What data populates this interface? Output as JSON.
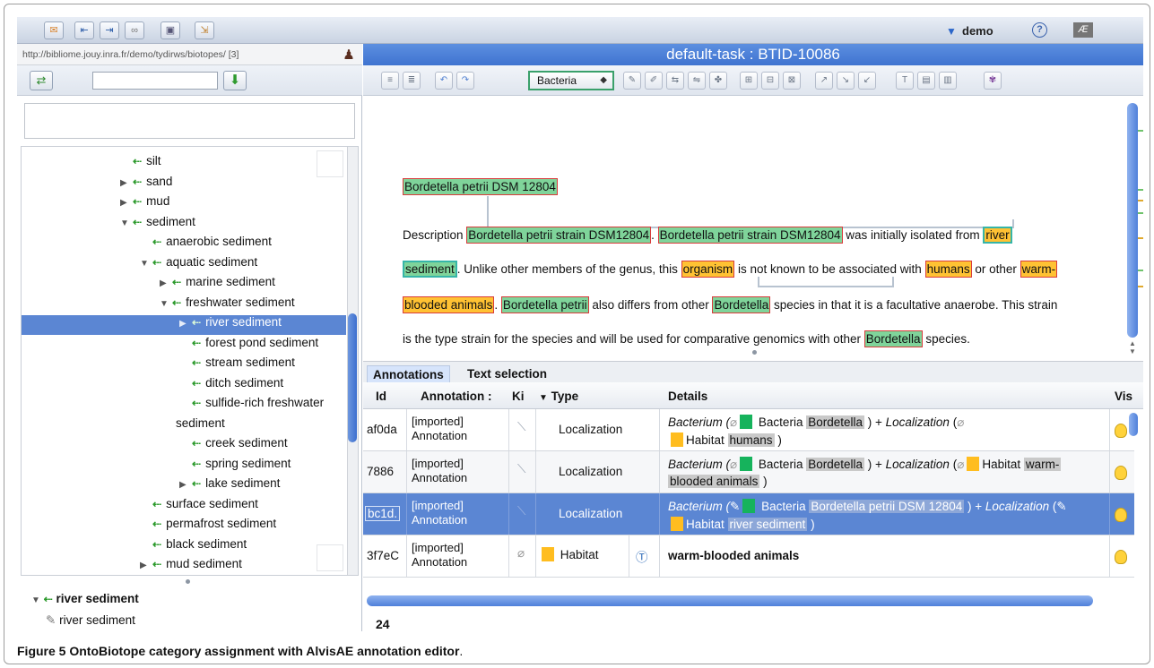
{
  "topbar": {
    "user": "demo",
    "help_label": "?",
    "logo": "Æ"
  },
  "left": {
    "url": "http://bibliome.jouy.inra.fr/demo/tydirws/biotopes/ [3]",
    "search": {
      "value": "",
      "placeholder": ""
    },
    "tree": [
      {
        "label": "silt",
        "twisty": "",
        "depth": 0,
        "selected": false
      },
      {
        "label": "sand",
        "twisty": "▶",
        "depth": 0,
        "selected": false
      },
      {
        "label": "mud",
        "twisty": "▶",
        "depth": 0,
        "selected": false
      },
      {
        "label": "sediment",
        "twisty": "▼",
        "depth": 0,
        "selected": false
      },
      {
        "label": "anaerobic sediment",
        "twisty": "",
        "depth": 1,
        "selected": false
      },
      {
        "label": "aquatic sediment",
        "twisty": "▼",
        "depth": 1,
        "selected": false
      },
      {
        "label": "marine sediment",
        "twisty": "▶",
        "depth": 2,
        "selected": false
      },
      {
        "label": "freshwater sediment",
        "twisty": "▼",
        "depth": 2,
        "selected": false
      },
      {
        "label": "river sediment",
        "twisty": "▶",
        "depth": 3,
        "selected": true
      },
      {
        "label": "forest pond sediment",
        "twisty": "",
        "depth": 3,
        "selected": false
      },
      {
        "label": "stream sediment",
        "twisty": "",
        "depth": 3,
        "selected": false
      },
      {
        "label": "ditch sediment",
        "twisty": "",
        "depth": 3,
        "selected": false
      },
      {
        "label": "sulfide-rich freshwater",
        "twisty": "",
        "depth": 3,
        "selected": false
      },
      {
        "label": "sediment",
        "twisty": "",
        "depth": 3,
        "selected": false
      },
      {
        "label": "creek sediment",
        "twisty": "",
        "depth": 3,
        "selected": false
      },
      {
        "label": "spring sediment",
        "twisty": "",
        "depth": 3,
        "selected": false
      },
      {
        "label": "lake sediment",
        "twisty": "▶",
        "depth": 3,
        "selected": false
      },
      {
        "label": "surface sediment",
        "twisty": "",
        "depth": 1,
        "selected": false
      },
      {
        "label": "permafrost sediment",
        "twisty": "",
        "depth": 1,
        "selected": false
      },
      {
        "label": "black sediment",
        "twisty": "",
        "depth": 1,
        "selected": false
      },
      {
        "label": "mud sediment",
        "twisty": "▶",
        "depth": 1,
        "selected": false
      }
    ],
    "detail": {
      "node": "river sediment",
      "term": "river sediment"
    }
  },
  "editor": {
    "title": "default-task : BTID-10086",
    "type_select": "Bacteria",
    "doc": {
      "title_ann": "Bordetella petrii DSM 12804",
      "l1_a": "Description ",
      "l1_b": "Bordetella petrii strain DSM12804",
      "l1_c": ". ",
      "l1_d": "Bordetella petrii strain DSM12804",
      "l1_e": " was initially isolated from ",
      "l1_f": "river",
      "l2_a": "sediment",
      "l2_b": ". Unlike other members of the genus, this ",
      "l2_c": "organism",
      "l2_d": " is not known to be associated with ",
      "l2_e": "humans",
      "l2_f": " or other ",
      "l2_g": "warm-",
      "l3_a": "blooded animals",
      "l3_b": ". ",
      "l3_c": "Bordetella petrii",
      "l3_d": " also differs from other ",
      "l3_e": "Bordetella",
      "l3_f": " species in that it is a facultative anaerobe. This strain",
      "l4_a": "is the type strain for the species and will be used for comparative genomics with other ",
      "l4_b": "Bordetella",
      "l4_c": " species."
    },
    "tabs": [
      "Annotations",
      "Text selection"
    ],
    "grid": {
      "headers": {
        "id": "Id",
        "annotation": "Annotation :",
        "kind": "Ki",
        "type": "Type",
        "details": "Details",
        "vis": "Vis"
      },
      "rows": [
        {
          "id": "af0da",
          "ann1": "[imported]",
          "ann2": "Annotation",
          "type": "Localization",
          "d1": "Bacterium (",
          "d2": " Bacteria ",
          "d3": "Bordetella",
          "d4": " ) + ",
          "d5": "Localization",
          "d6": " (",
          "d7": "Habitat ",
          "d8": "humans",
          "d9": " )"
        },
        {
          "id": "7886",
          "ann1": "[imported]",
          "ann2": "Annotation",
          "type": "Localization",
          "d1": "Bacterium (",
          "d2": " Bacteria ",
          "d3": "Bordetella",
          "d4": " ) + ",
          "d5": "Localization",
          "d6": " (",
          "d7": "Habitat ",
          "d8": "warm-",
          "d8b": "blooded animals",
          "d9": " )"
        },
        {
          "id": "bc1d.",
          "ann1": "[imported]",
          "ann2": "Annotation",
          "type": "Localization",
          "d1": "Bacterium (",
          "d2": " Bacteria ",
          "d3": "Bordetella petrii DSM 12804",
          "d4": " ) + ",
          "d5": "Localization",
          "d6": " (",
          "d7": "Habitat ",
          "d8": "river sediment",
          "d9": " )"
        },
        {
          "id": "3f7eC",
          "ann1": "[imported]",
          "ann2": "Annotation",
          "type": "Habitat",
          "detail": "warm-blooded animals"
        }
      ],
      "count": "24"
    }
  },
  "caption": {
    "bold": "Figure 5 OntoBiotope category assignment with AlvisAE annotation editor",
    "rest": "."
  },
  "colors": {
    "accent": "#5b86d3",
    "bacteria": "#7fd49a",
    "habitat": "#ffc233",
    "title_bar": "#4a7fd8"
  }
}
